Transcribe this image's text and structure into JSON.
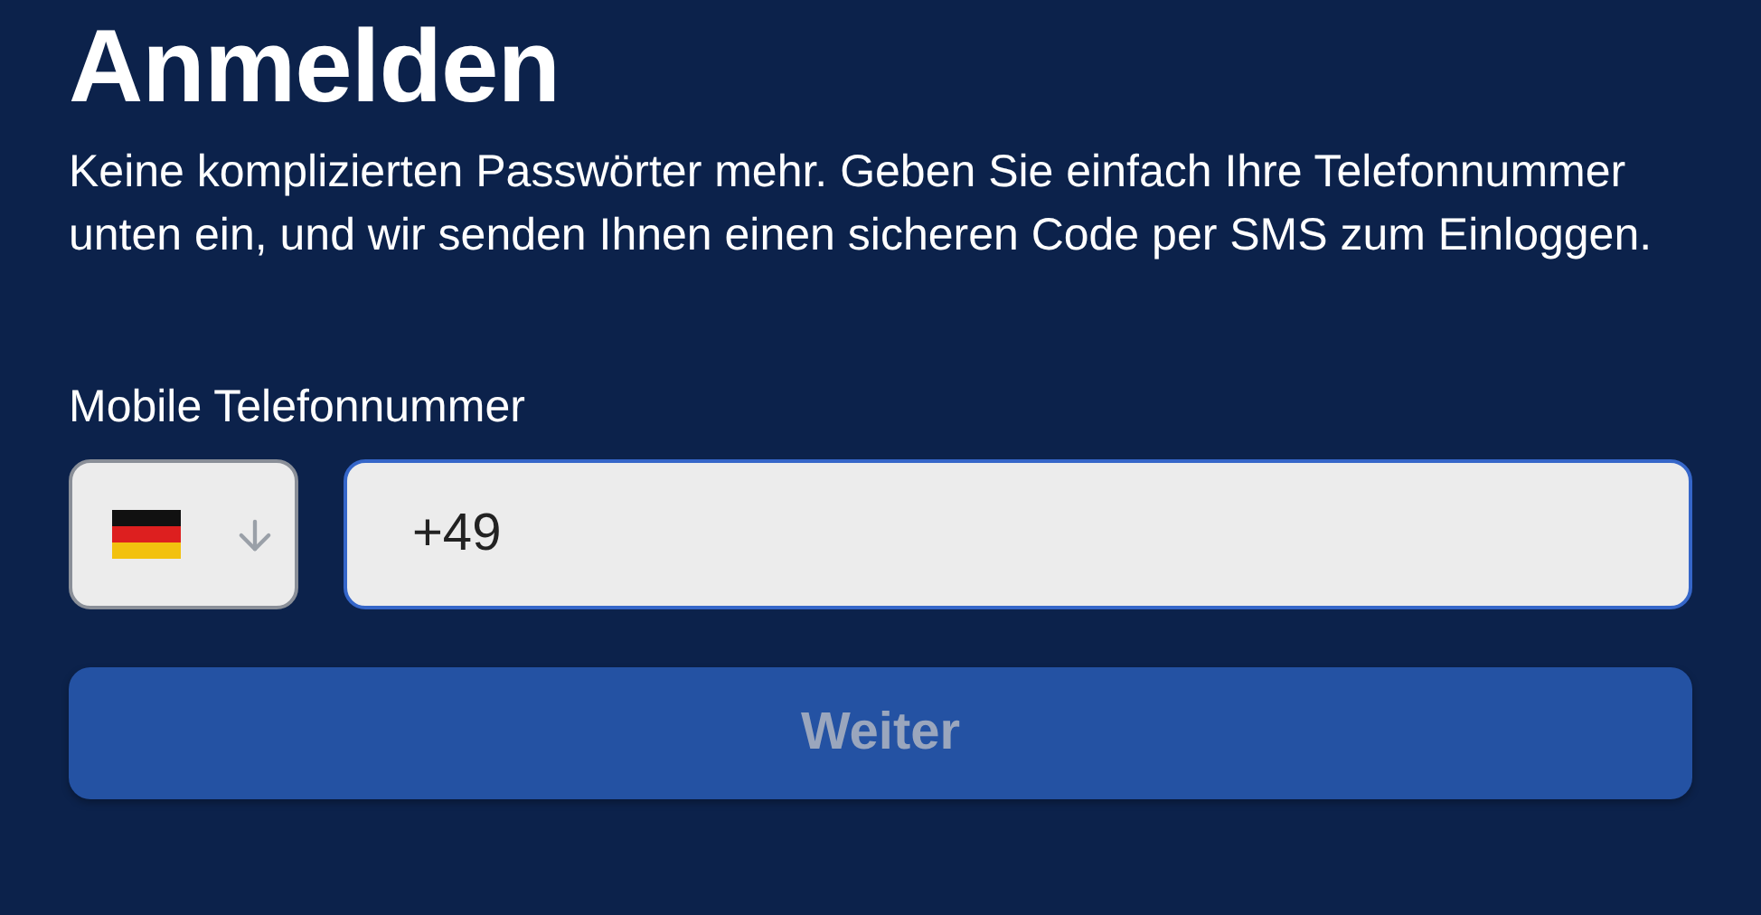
{
  "title": "Anmelden",
  "description": "Keine komplizierten Passwörter mehr. Geben Sie einfach Ihre Telefonnummer unten ein, und wir senden Ihnen einen sicheren Code per SMS zum Einloggen.",
  "phone": {
    "label": "Mobile Telefonnummer",
    "value": "+49",
    "focused": true
  },
  "submit": {
    "label": "Weiter",
    "disabled": true
  }
}
